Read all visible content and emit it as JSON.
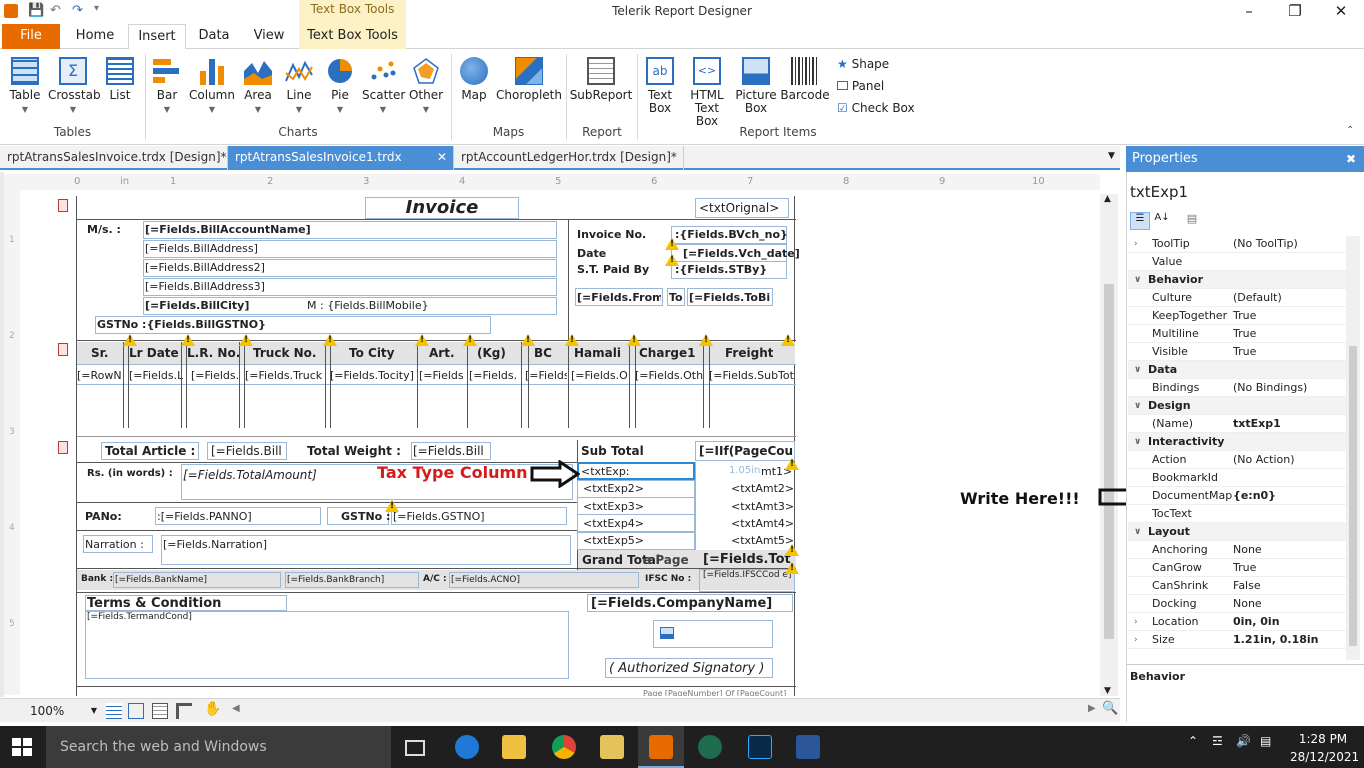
{
  "window": {
    "title": "Telerik Report Designer",
    "context_band": "Text Box Tools"
  },
  "ribbon_tabs": [
    "File",
    "Home",
    "Insert",
    "Data",
    "View",
    "Text Box Tools"
  ],
  "ribbon": {
    "tables": {
      "items": [
        "Table",
        "Crosstab",
        "List"
      ],
      "group": "Tables"
    },
    "charts": {
      "items": [
        "Bar",
        "Column",
        "Area",
        "Line",
        "Pie",
        "Scatter",
        "Other"
      ],
      "group": "Charts"
    },
    "maps": {
      "items": [
        "Map",
        "Choropleth"
      ],
      "group": "Maps"
    },
    "report": {
      "items": [
        "SubReport"
      ],
      "group": "Report"
    },
    "report_items": {
      "text_box": "Text Box",
      "html_text_box": "HTML Text Box",
      "picture_box": "Picture Box",
      "barcode": "Barcode",
      "shape": "Shape",
      "panel": "Panel",
      "check_box": "Check Box",
      "group": "Report Items"
    }
  },
  "doc_tabs": [
    "rptAtransSalesInvoice.trdx [Design]*",
    "rptAtransSalesInvoice1.trdx [Design]",
    "rptAccountLedgerHor.trdx [Design]*"
  ],
  "ruler": {
    "h": [
      "0",
      "in",
      "1",
      "2",
      "3",
      "4",
      "5",
      "6",
      "7",
      "8",
      "9",
      "10"
    ],
    "v": [
      "1",
      "2",
      "3",
      "4",
      "5"
    ]
  },
  "report": {
    "title": "Invoice",
    "txt_orignal": "<txtOrignal>",
    "ms_label": "M/s. :",
    "bill_account": "[=Fields.BillAccountName]",
    "bill_address": "[=Fields.BillAddress]",
    "bill_address2": "[=Fields.BillAddress2]",
    "bill_address3": "[=Fields.BillAddress3]",
    "bill_city": "[=Fields.BillCity]",
    "bill_mobile": "M : {Fields.BillMobile}",
    "gst_no": "GSTNo :{Fields.BillGSTNO}",
    "invoice_no_label": "Invoice No.",
    "invoice_no_val": ":{Fields.BVch_no}",
    "date_label": "Date",
    "date_val": "[=Fields.Vch_date]",
    "st_paid_label": "S.T. Paid By",
    "st_paid_val": ":{Fields.STBy}",
    "from_val": "[=Fields.From",
    "to_label": "To",
    "to_val": "[=Fields.ToBil",
    "columns": [
      "Sr.",
      "Lr Date",
      "L.R. No.",
      "Truck No.",
      "To City",
      "Art.",
      "(Kg)",
      "BC",
      "Hamali",
      "Charge1",
      "Freight"
    ],
    "cells": [
      "[=RowN",
      "[=Fields.L",
      "[=Fields.",
      "[=Fields.Truck",
      "[=Fields.Tocity]",
      "[=Fields",
      "[=Fields.",
      "[=Fields",
      "[=Fields.O",
      "[=Fields.Oth",
      "[=Fields.SubTot"
    ],
    "total_article_label": "Total Article :",
    "total_article_val": "[=Fields.Bill",
    "total_weight_label": "Total Weight :",
    "total_weight_val": "[=Fields.Bill",
    "rs_words_label": "Rs. (in words) :",
    "total_amount": "[=Fields.TotalAmount]",
    "sub_total_label": "Sub Total",
    "sub_total_val": "[=IIf(PageCou",
    "txt_exp1": "<txtExp:",
    "size_hint": "1.05in",
    "txt_amt1": "mt1>",
    "txt_exp2": "<txtExp2>",
    "txt_amt2": "<txtAmt2>",
    "txt_exp3": "<txtExp3>",
    "txt_amt3": "<txtAmt3>",
    "txt_exp4": "<txtExp4>",
    "txt_amt4": "<txtAmt4>",
    "txt_exp5": "<txtExp5>",
    "txt_amt5": "<txtAmt5>",
    "grand_total": "Grand Total",
    "grand_total_overlap": "e Page",
    "grand_total_val": "[=Fields.Tot",
    "pan_label": "PANo:",
    "pan_val": ":[=Fields.PANNO]",
    "gstno_label": "GSTNo :",
    "gstno_val": "[=Fields.GSTNO]",
    "narration_label": "Narration :",
    "narration_val": "[=Fields.Narration]",
    "bank_label": "Bank :",
    "bank_name": "[=Fields.BankName]",
    "bank_branch": "[=Fields.BankBranch]",
    "ac_label": "A/C :",
    "ac_val": "[=Fields.ACNO]",
    "ifsc_label": "IFSC No :",
    "ifsc_val": "[=Fields.IFSCCod e]",
    "terms_label": "Terms & Condition",
    "terms_val": "[=Fields.TermandCond]",
    "company_name": "[=Fields.CompanyName]",
    "signatory": "( Authorized Signatory )",
    "footer_partial": "Page [PageNumber] Of [PageCount]"
  },
  "annotations": {
    "tax_type": "Tax Type Column",
    "write_here": "Write Here!!!"
  },
  "zoom": "100%",
  "properties": {
    "header": "Properties",
    "object_name": "txtExp1",
    "rows": [
      {
        "type": "prop",
        "name": "ToolTip",
        "value": "(No ToolTip)",
        "expand": true
      },
      {
        "type": "prop",
        "name": "Value",
        "value": ""
      },
      {
        "type": "cat",
        "name": "Behavior"
      },
      {
        "type": "prop",
        "name": "Culture",
        "value": "(Default)"
      },
      {
        "type": "prop",
        "name": "KeepTogether",
        "value": "True"
      },
      {
        "type": "prop",
        "name": "Multiline",
        "value": "True"
      },
      {
        "type": "prop",
        "name": "Visible",
        "value": "True"
      },
      {
        "type": "cat",
        "name": "Data"
      },
      {
        "type": "prop",
        "name": "Bindings",
        "value": "(No Bindings)"
      },
      {
        "type": "cat",
        "name": "Design"
      },
      {
        "type": "prop",
        "name": "(Name)",
        "value": "txtExp1",
        "bold": true
      },
      {
        "type": "cat",
        "name": "Interactivity"
      },
      {
        "type": "prop",
        "name": "Action",
        "value": "(No Action)"
      },
      {
        "type": "prop",
        "name": "BookmarkId",
        "value": ""
      },
      {
        "type": "prop",
        "name": "DocumentMap",
        "value": "{e:n0}",
        "bold": true
      },
      {
        "type": "prop",
        "name": "TocText",
        "value": ""
      },
      {
        "type": "cat",
        "name": "Layout"
      },
      {
        "type": "prop",
        "name": "Anchoring",
        "value": "None"
      },
      {
        "type": "prop",
        "name": "CanGrow",
        "value": "True"
      },
      {
        "type": "prop",
        "name": "CanShrink",
        "value": "False"
      },
      {
        "type": "prop",
        "name": "Docking",
        "value": "None"
      },
      {
        "type": "prop",
        "name": "Location",
        "value": "0in, 0in",
        "bold": true,
        "expand": true
      },
      {
        "type": "prop",
        "name": "Size",
        "value": "1.21in, 0.18in",
        "bold": true,
        "expand": true
      }
    ],
    "description": "Behavior"
  },
  "taskbar": {
    "search": "Search the web and Windows",
    "time": "1:28 PM",
    "date": "28/12/2021"
  },
  "colors": {
    "accent": "#4a8fd6",
    "file_tab": "#e86b00",
    "ctx_band": "#fdf1c6",
    "warn": "#f3c300",
    "annot_red": "#d41c1c"
  }
}
